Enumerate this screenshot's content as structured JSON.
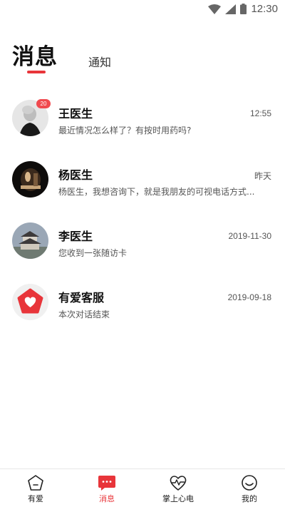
{
  "status_bar": {
    "time": "12:30",
    "icons": [
      "wifi-icon",
      "signal-icon",
      "battery-icon"
    ]
  },
  "header": {
    "tabs": [
      {
        "label": "消息",
        "active": true
      },
      {
        "label": "通知",
        "active": false
      }
    ],
    "accent_color": "#e8353a"
  },
  "messages": [
    {
      "name": "王医生",
      "time": "12:55",
      "preview": "最近情况怎么样了？有按时用药吗?",
      "badge": "20",
      "avatar": "doctor-wang-avatar"
    },
    {
      "name": "杨医生",
      "time": "昨天",
      "preview": "杨医生，我想咨询下，就是我朋友的可视电话方式...",
      "avatar": "doctor-yang-avatar"
    },
    {
      "name": "李医生",
      "time": "2019-11-30",
      "preview": "您收到一张随访卡",
      "avatar": "doctor-li-avatar"
    },
    {
      "name": "有爱客服",
      "time": "2019-09-18",
      "preview": "本次对话结束",
      "avatar": "customer-service-avatar"
    }
  ],
  "bottom_nav": [
    {
      "label": "有爱",
      "icon": "home-icon",
      "active": false
    },
    {
      "label": "消息",
      "icon": "chat-icon",
      "active": true
    },
    {
      "label": "掌上心电",
      "icon": "heart-ecg-icon",
      "active": false
    },
    {
      "label": "我的",
      "icon": "profile-icon",
      "active": false
    }
  ]
}
